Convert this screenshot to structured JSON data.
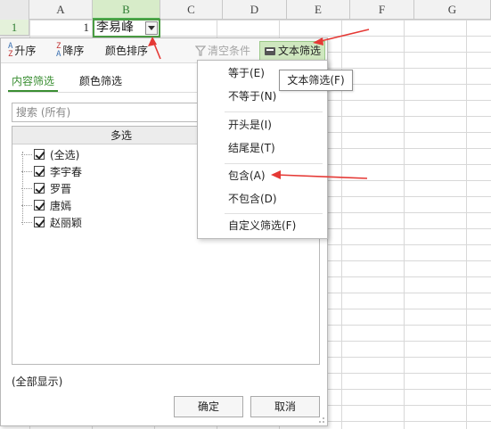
{
  "sheet": {
    "columns": [
      "A",
      "B",
      "C",
      "D",
      "E",
      "F",
      "G"
    ],
    "selected_column": "B",
    "row_numbers": [
      "1"
    ],
    "cells": {
      "A1": "1",
      "B1": "李易峰"
    }
  },
  "filter_panel": {
    "toolbar": {
      "sort_asc": "升序",
      "sort_desc": "降序",
      "color_sort": "颜色排序",
      "clear_conditions": "清空条件",
      "text_filter": "文本筛选"
    },
    "tabs": [
      "内容筛选",
      "颜色筛选"
    ],
    "active_tab": "内容筛选",
    "search_placeholder": "搜索 (所有)",
    "list_header": "多选",
    "items": [
      {
        "label": "(全选)",
        "checked": true
      },
      {
        "label": "李宇春",
        "checked": true
      },
      {
        "label": "罗晋",
        "checked": true
      },
      {
        "label": "唐嫣",
        "checked": true
      },
      {
        "label": "赵丽颖",
        "checked": true
      }
    ],
    "show_all": "(全部显示)",
    "ok": "确定",
    "cancel": "取消"
  },
  "text_filter_menu": {
    "items": [
      "等于(E)",
      "不等于(N)",
      "开头是(I)",
      "结尾是(T)",
      "包含(A)",
      "不包含(D)",
      "自定义筛选(F)"
    ]
  },
  "tooltip": "文本筛选(F)",
  "colors": {
    "accent_green": "#3a8e32",
    "annotation_red": "#e53935"
  }
}
